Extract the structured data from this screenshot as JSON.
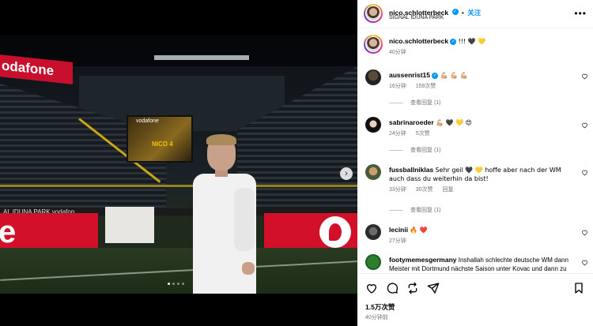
{
  "header": {
    "username": "nico.schlotterbeck",
    "follow_label": "关注",
    "separator": "•",
    "location": "SIGNAL IDUNA PARK",
    "more_icon": "more-horizontal-icon"
  },
  "photo": {
    "banner_top": "odafone",
    "band_text": "AL IDUNA PARK  vodafon",
    "screen_top": "vodafone",
    "screen_name": "NICO 4",
    "board_left": "e",
    "carousel": {
      "total": 4,
      "active_index": 0
    }
  },
  "caption": {
    "username": "nico.schlotterbeck",
    "text": "!!! 🖤 💛",
    "time": "40分钟"
  },
  "comments": [
    {
      "username": "aussenrist15",
      "verified": true,
      "text": "💪🏼 💪🏼 💪🏼",
      "time": "16分钟",
      "likes": "159次赞",
      "replies": "查看回复 (1)"
    },
    {
      "username": "sabrinaroeder",
      "verified": false,
      "text": "💪🏼 🖤 💛 😍",
      "time": "24分钟",
      "likes": "5次赞",
      "replies": "查看回复 (1)"
    },
    {
      "username": "fussballniklas",
      "verified": false,
      "text": "Sehr geil 🖤 💛 hoffe aber nach der WM auch dass du weiterhin da bist!",
      "time": "33分钟",
      "likes": "30次赞",
      "reply_label": "回复",
      "replies": "查看回复 (1)"
    },
    {
      "username": "lecinii",
      "verified": false,
      "text": "🔥 ❤️",
      "time": "27分钟",
      "likes": "",
      "replies": ""
    },
    {
      "username": "footymemesgermany",
      "verified": false,
      "text": "Inshallah schlechte deutsche WM dann Meister mit Dortmund nächste Saison unter Kovac und dann zu",
      "time": "",
      "likes": "",
      "replies": ""
    }
  ],
  "actions": {
    "likes": "1.5万次赞",
    "posted": "40分钟前"
  },
  "colors": {
    "accent": "#0095f6",
    "vodafone_red": "#d2102a",
    "bvb_yellow": "#f2c200"
  }
}
